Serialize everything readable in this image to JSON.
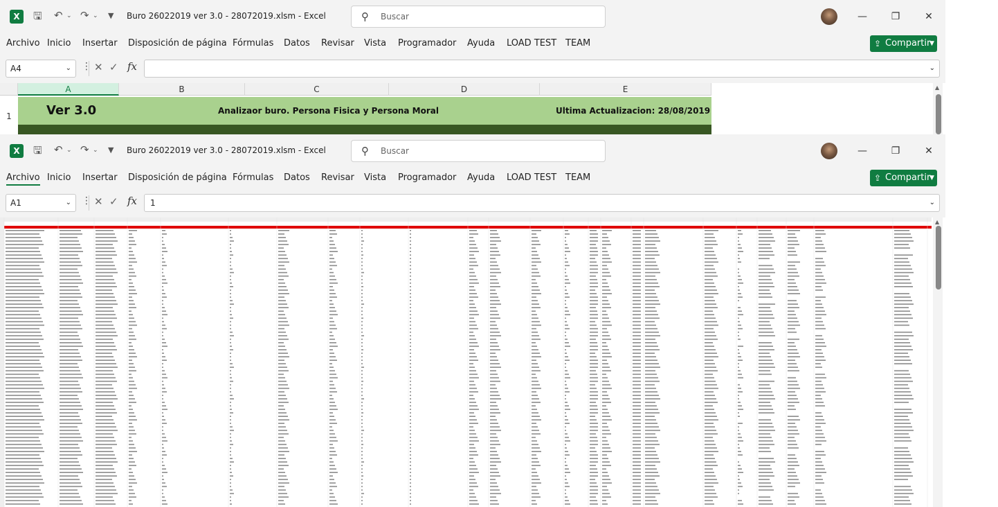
{
  "windows": [
    {
      "id": "top",
      "title": "Buro 26022019 ver 3.0 - 28072019.xlsm  -  Excel",
      "search_placeholder": "Buscar",
      "name_box": "A4",
      "formula": "",
      "active_menu": null
    },
    {
      "id": "bottom",
      "title": "Buro 26022019 ver 3.0 - 28072019.xlsm  -  Excel",
      "search_placeholder": "Buscar",
      "name_box": "A1",
      "formula": "1",
      "active_menu": "Archivo"
    }
  ],
  "menu": [
    "Archivo",
    "Inicio",
    "Insertar",
    "Disposición de página",
    "Fórmulas",
    "Datos",
    "Revisar",
    "Vista",
    "Programador",
    "Ayuda",
    "LOAD TEST",
    "TEAM"
  ],
  "share_label": "Compartir",
  "icons": {
    "app": "excel-icon",
    "save": "save-icon",
    "undo": "undo-icon",
    "redo": "redo-icon",
    "customize": "customize-quick-access-icon",
    "search": "search-icon",
    "minimize": "minimize-icon",
    "restore": "restore-icon",
    "close": "close-icon",
    "cancel": "cancel-icon",
    "enter": "enter-icon",
    "function": "fx-icon"
  },
  "top_sheet": {
    "columns": [
      "A",
      "B",
      "C",
      "D",
      "E"
    ],
    "row_number": "1",
    "version_text": "Ver 3.0",
    "heading_text": "Analizaor buro. Persona Fisica y Persona Moral",
    "updated_text": "Ultima Actualizacion: 28/08/2019",
    "colors": {
      "band": "#a9d18e",
      "dark_band": "#385723",
      "selected_header": "#107c41"
    }
  },
  "bottom_sheet": {
    "rows_start": 1,
    "rows_end": 80,
    "header_row_color": "#e00000"
  }
}
